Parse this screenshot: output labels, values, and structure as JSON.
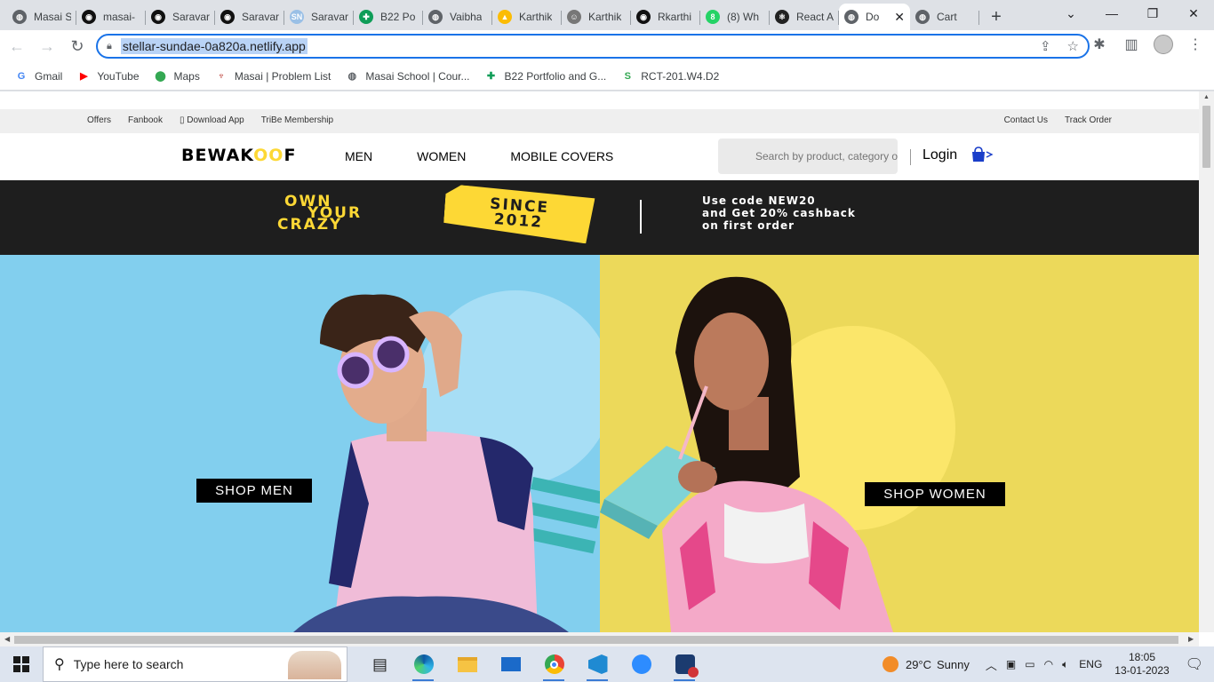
{
  "browser": {
    "tabs": [
      {
        "title": "Masai S",
        "favicon": "globe-icon"
      },
      {
        "title": "masai-",
        "favicon": "github-icon"
      },
      {
        "title": "Saravar",
        "favicon": "github-icon"
      },
      {
        "title": "Saravar",
        "favicon": "github-icon"
      },
      {
        "title": "Saravar",
        "favicon": "sn-icon",
        "favicon_text": "SN"
      },
      {
        "title": "B22 Po",
        "favicon": "sheets-icon"
      },
      {
        "title": "Vaibha",
        "favicon": "globe-icon"
      },
      {
        "title": "Karthik",
        "favicon": "drive-icon"
      },
      {
        "title": "Karthik",
        "favicon": "person-icon"
      },
      {
        "title": "Rkarthi",
        "favicon": "github-icon"
      },
      {
        "title": "(8) Wh",
        "favicon": "whatsapp-icon",
        "favicon_text": "8"
      },
      {
        "title": "React A",
        "favicon": "react-icon"
      },
      {
        "title": "Do",
        "favicon": "globe-icon",
        "active": true
      },
      {
        "title": "Cart",
        "favicon": "globe-icon"
      }
    ],
    "url": "stellar-sundae-0a820a.netlify.app",
    "bookmarks": [
      {
        "label": "Gmail",
        "icon": "google-icon",
        "icon_text": "G",
        "color": "#4285f4"
      },
      {
        "label": "YouTube",
        "icon": "youtube-icon",
        "icon_text": "▶",
        "color": "#ff0000"
      },
      {
        "label": "Maps",
        "icon": "maps-pin-icon",
        "icon_text": "⬤",
        "color": "#34a853"
      },
      {
        "label": "Masai | Problem List",
        "icon": "masai-icon",
        "icon_text": "♆",
        "color": "#b3261e"
      },
      {
        "label": "Masai School | Cour...",
        "icon": "globe-icon",
        "icon_text": "◍",
        "color": "#5f6368"
      },
      {
        "label": "B22 Portfolio and G...",
        "icon": "sheets-icon",
        "icon_text": "✚",
        "color": "#0f9d58"
      },
      {
        "label": "RCT-201.W4.D2",
        "icon": "s-icon",
        "icon_text": "S",
        "color": "#34a853"
      }
    ]
  },
  "site": {
    "topbar": {
      "left": [
        "Offers",
        "Fanbook",
        "▯ Download App",
        "TriBe Membership"
      ],
      "right": [
        "Contact Us",
        "Track Order"
      ]
    },
    "logo": {
      "pre": "BEWAK",
      "mid": "OO",
      "post": "F"
    },
    "menu": [
      "MEN",
      "WOMEN",
      "MOBILE COVERS"
    ],
    "search_placeholder": "Search by product, category or collection",
    "login": "Login",
    "promo": {
      "own_lines": [
        "OWN",
        "YOUR",
        "CRAZY"
      ],
      "since": [
        "SINCE",
        "2012"
      ],
      "code_lines": [
        "Use code NEW20",
        "and Get 20% cashback",
        "on first order"
      ]
    },
    "shop_men": "SHOP MEN",
    "shop_women": "SHOP WOMEN",
    "colors": {
      "men_bg": "#82cfee",
      "women_bg": "#ecd95a",
      "promo_bg": "#1e1e1e",
      "accent_yellow": "#fdd835"
    }
  },
  "taskbar": {
    "search_placeholder": "Type here to search",
    "apps": [
      "task-view-icon",
      "edge-icon",
      "file-explorer-icon",
      "mail-icon",
      "chrome-icon",
      "vscode-icon",
      "zoom-icon",
      "teams-icon"
    ],
    "weather": {
      "temp": "29°C",
      "condition": "Sunny"
    },
    "lang": "ENG",
    "time": "18:05",
    "date": "13-01-2023"
  }
}
